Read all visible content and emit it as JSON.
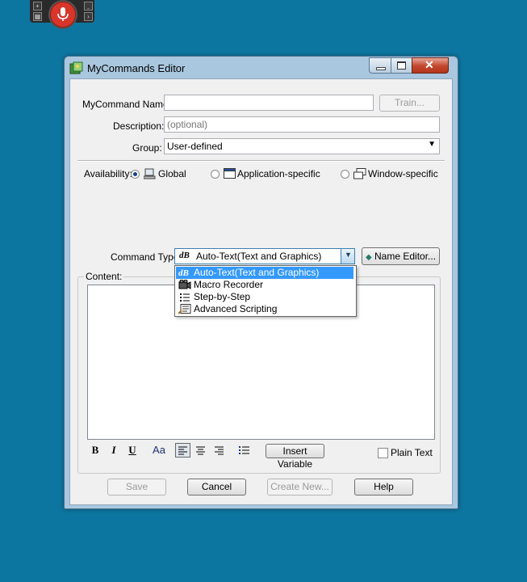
{
  "window": {
    "title": "MyCommands Editor"
  },
  "form": {
    "name_label": "MyCommand Name:",
    "name_value": "",
    "train_label": "Train...",
    "description_label": "Description:",
    "description_placeholder": "(optional)",
    "group_label": "Group:",
    "group_value": "User-defined"
  },
  "availability": {
    "label": "Availability:",
    "options": [
      {
        "label": "Global",
        "selected": true
      },
      {
        "label": "Application-specific",
        "selected": false
      },
      {
        "label": "Window-specific",
        "selected": false
      }
    ]
  },
  "command_type": {
    "label": "Command Type:",
    "value": "Auto-Text(Text and Graphics)",
    "name_editor_label": "Name Editor...",
    "options": [
      {
        "label": "Auto-Text(Text and Graphics)",
        "icon": "auto-text-icon",
        "selected": true
      },
      {
        "label": "Macro Recorder",
        "icon": "macro-recorder-icon",
        "selected": false
      },
      {
        "label": "Step-by-Step",
        "icon": "step-by-step-icon",
        "selected": false
      },
      {
        "label": "Advanced Scripting",
        "icon": "advanced-scripting-icon",
        "selected": false
      }
    ]
  },
  "content": {
    "label": "Content:",
    "bold": "B",
    "italic": "I",
    "underline": "U",
    "font": "Aa",
    "insert_variable_label": "Insert Variable",
    "plain_text_label": "Plain Text"
  },
  "footer": {
    "save_label": "Save",
    "cancel_label": "Cancel",
    "create_new_label": "Create New...",
    "help_label": "Help"
  }
}
